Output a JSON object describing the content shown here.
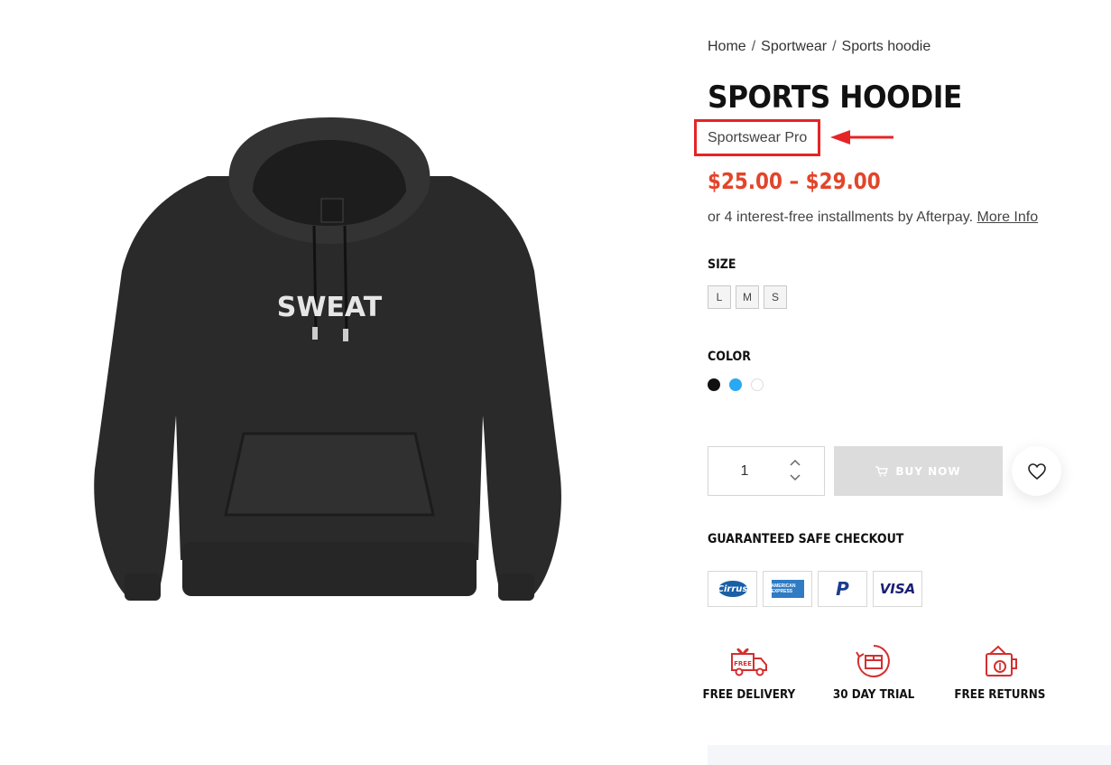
{
  "breadcrumb": {
    "items": [
      "Home",
      "Sportwear",
      "Sports hoodie"
    ],
    "separator": "/"
  },
  "product": {
    "title": "SPORTS HOODIE",
    "brand": "Sportswear Pro",
    "price_range": "$25.00 – $29.00",
    "product_image_text": "SWEAT"
  },
  "afterpay": {
    "text": "or 4 interest-free installments by Afterpay.",
    "link": "More Info"
  },
  "size": {
    "label": "SIZE",
    "options": [
      "L",
      "M",
      "S"
    ]
  },
  "color": {
    "label": "COLOR",
    "swatches": [
      {
        "name": "black",
        "hex": "#111111"
      },
      {
        "name": "blue",
        "hex": "#29a9f3"
      },
      {
        "name": "white",
        "hex": "#ffffff"
      }
    ]
  },
  "cart": {
    "quantity": "1",
    "buy_label": "BUY NOW"
  },
  "checkout": {
    "label": "GUARANTEED SAFE CHECKOUT",
    "payments": [
      {
        "name": "Cirrus",
        "text": "Cirrus",
        "icon": "cirrus-icon"
      },
      {
        "name": "American Express",
        "text": "AMERICAN EXPRESS",
        "icon": "amex-icon"
      },
      {
        "name": "PayPal",
        "text": "P",
        "icon": "paypal-icon"
      },
      {
        "name": "Visa",
        "text": "VISA",
        "icon": "visa-icon"
      }
    ]
  },
  "features": [
    {
      "label": "FREE DELIVERY",
      "icon": "delivery-truck-icon",
      "badge": "FREE"
    },
    {
      "label": "30 DAY TRIAL",
      "icon": "box-trial-icon"
    },
    {
      "label": "FREE RETURNS",
      "icon": "returns-wallet-icon"
    }
  ],
  "colors": {
    "accent_red": "#e52426",
    "price": "#e2452b",
    "buy_button": "#dcdcdc"
  }
}
